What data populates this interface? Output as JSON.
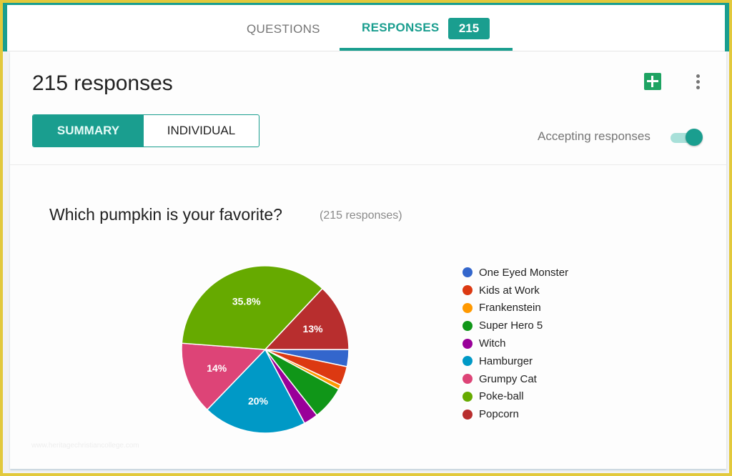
{
  "tabs": {
    "questions_label": "QUESTIONS",
    "responses_label": "RESPONSES",
    "responses_count": "215"
  },
  "summary_header": {
    "title": "215 responses",
    "view_toggle": {
      "summary_label": "SUMMARY",
      "individual_label": "INDIVIDUAL",
      "selected": "SUMMARY"
    },
    "sheets_icon": "google-sheets-icon",
    "more_icon": "more-vert-icon",
    "accepting_label": "Accepting responses",
    "accepting_on": true
  },
  "colors": {
    "accent": "#1a9e8f",
    "sheets": "#1ea362"
  },
  "question": {
    "title": "Which pumpkin is your favorite?",
    "count_label": "(215 responses)"
  },
  "watermark": "www.heritagechristiancollege.com",
  "chart_data": {
    "type": "pie",
    "title": "Which pumpkin is your favorite?",
    "total": 215,
    "legend_position": "right",
    "start_angle_deg": 90,
    "slices": [
      {
        "label": "One Eyed Monster",
        "value": 7,
        "percent": 3.3,
        "color": "#3366cc",
        "data_label": ""
      },
      {
        "label": "Kids at Work",
        "value": 8,
        "percent": 3.7,
        "color": "#dc3912",
        "data_label": ""
      },
      {
        "label": "Frankenstein",
        "value": 2,
        "percent": 0.9,
        "color": "#ff9900",
        "data_label": ""
      },
      {
        "label": "Super Hero 5",
        "value": 14,
        "percent": 6.5,
        "color": "#109618",
        "data_label": ""
      },
      {
        "label": "Witch",
        "value": 6,
        "percent": 2.8,
        "color": "#990099",
        "data_label": ""
      },
      {
        "label": "Hamburger",
        "value": 43,
        "percent": 20,
        "color": "#0099c6",
        "data_label": "20%"
      },
      {
        "label": "Grumpy Cat",
        "value": 30,
        "percent": 14,
        "color": "#dd4477",
        "data_label": "14%"
      },
      {
        "label": "Poke-ball",
        "value": 77,
        "percent": 35.8,
        "color": "#66aa00",
        "data_label": "35.8%"
      },
      {
        "label": "Popcorn",
        "value": 28,
        "percent": 13,
        "color": "#b82e2e",
        "data_label": "13%"
      }
    ]
  }
}
